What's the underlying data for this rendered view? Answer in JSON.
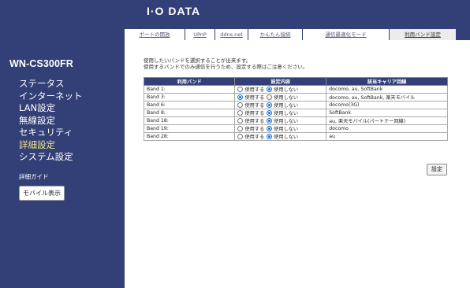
{
  "brand": {
    "logo": "I·O DATA"
  },
  "sidebar": {
    "model": "WN-CS300FR",
    "items": [
      {
        "label": "ステータス",
        "active": false
      },
      {
        "label": "インターネット",
        "active": false
      },
      {
        "label": "LAN設定",
        "active": false
      },
      {
        "label": "無線設定",
        "active": false
      },
      {
        "label": "セキュリティ",
        "active": false
      },
      {
        "label": "詳細設定",
        "active": true
      },
      {
        "label": "システム設定",
        "active": false
      }
    ],
    "guide": "詳細ガイド",
    "mobile_button": "モバイル表示"
  },
  "tabs": [
    {
      "label": "ポートの開放",
      "active": false
    },
    {
      "label": "UPnP",
      "active": false
    },
    {
      "label": "ddns.net",
      "active": false
    },
    {
      "label": "かんたん接続",
      "active": false
    },
    {
      "label": "通信最適化モード",
      "active": false
    },
    {
      "label": "利用バンド設定",
      "active": true
    }
  ],
  "intro": {
    "line1": "使用したいバンドを選択することが出来ます。",
    "line2": "使用するバンドでのみ通信を行うため、設定する際はご注意ください。"
  },
  "table": {
    "headers": [
      "利用バンド",
      "設定内容",
      "該当キャリア回線"
    ],
    "option_use": "使用する",
    "option_nouse": "使用しない",
    "rows": [
      {
        "band": "Band 1:",
        "use": false,
        "carrier": "docomo, au, SoftBank"
      },
      {
        "band": "Band 3:",
        "use": true,
        "carrier": "docomo, au, SoftBank, 楽天モバイル"
      },
      {
        "band": "Band 6:",
        "use": false,
        "carrier": "docomo(3G)"
      },
      {
        "band": "Band 8:",
        "use": false,
        "carrier": "SoftBank"
      },
      {
        "band": "Band 18:",
        "use": false,
        "carrier": "au, 楽天モバイル(パートナー回線)"
      },
      {
        "band": "Band 19:",
        "use": false,
        "carrier": "docomo"
      },
      {
        "band": "Band 28:",
        "use": false,
        "carrier": "au"
      }
    ]
  },
  "actions": {
    "set_label": "設定"
  },
  "colors": {
    "nav_bg": "#333f77",
    "active_menu": "#f0e68c",
    "radio_accent": "#1a6fd1"
  }
}
